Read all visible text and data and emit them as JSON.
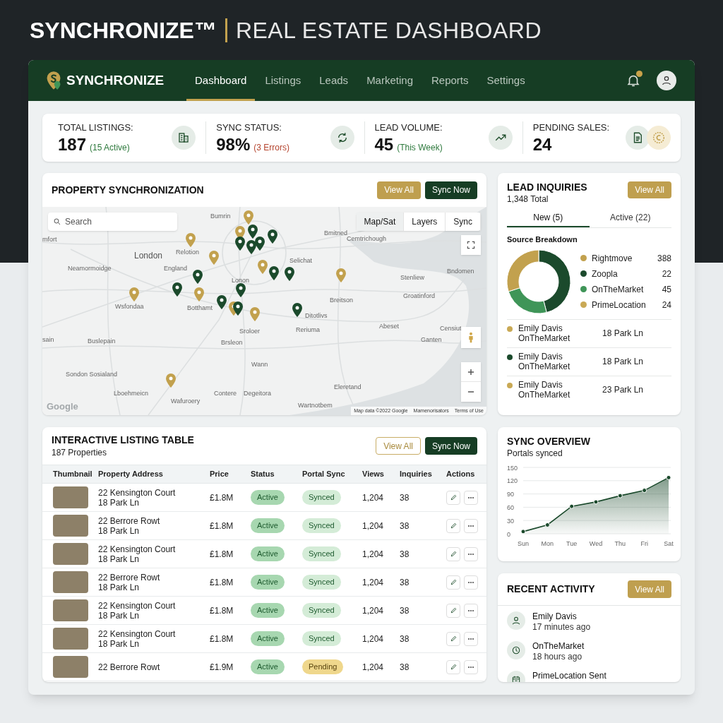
{
  "banner": {
    "brand": "SYNCHRONIZE™",
    "title": "REAL ESTATE DASHBOARD"
  },
  "nav": {
    "brand": "SYNCHRONIZE",
    "notification_dot": true,
    "tabs": [
      {
        "label": "Dashboard",
        "selected": true
      },
      {
        "label": "Listings",
        "selected": false
      },
      {
        "label": "Leads",
        "selected": false
      },
      {
        "label": "Marketing",
        "selected": false
      },
      {
        "label": "Reports",
        "selected": false
      },
      {
        "label": "Settings",
        "selected": false
      }
    ]
  },
  "stats": [
    {
      "label": "TOTAL LISTINGS:",
      "value": "187",
      "note": "(15 Active)",
      "kind": "positive"
    },
    {
      "label": "SYNC STATUS:",
      "value": "98%",
      "note": "(3 Errors)",
      "kind": "negative"
    },
    {
      "label": "LEAD VOLUME:",
      "value": "45",
      "note": "(This Week)",
      "kind": "positive"
    },
    {
      "label": "PENDING SALES:",
      "value": "24"
    }
  ],
  "property_sync": {
    "title": "PROPERTY SYNCHRONIZATION",
    "buttons": [
      {
        "label": "View All",
        "kind": "gold"
      },
      {
        "label": "Sync Now",
        "kind": "dark"
      }
    ],
    "map": {
      "search_placeholder": "Search",
      "views": [
        {
          "label": "Map/Sat",
          "selected": true
        },
        {
          "label": "Layers",
          "selected": false
        },
        {
          "label": "Sync",
          "selected": false
        }
      ],
      "place_labels": [
        "Bumrin",
        "Bmitned",
        "mfort",
        "Cemtrichough",
        "Relotion",
        "London",
        "Selichat",
        "Neamormoidge",
        "England",
        "Bndomen",
        "Lonon",
        "Stenliew",
        "Groatinford",
        "Breitson",
        "Wsfondaa",
        "Botthamt",
        "Ditotlivs",
        "Abeset",
        "Censiut",
        "Sroloer",
        "Reriuma",
        "sain",
        "Buslepain",
        "Brsleon",
        "Ganten",
        "Wann",
        "Sondon Sosialand",
        "Eleretand",
        "Lboehmeicn",
        "Contere",
        "Degeitora",
        "Wafuroery",
        "Wartnotbem"
      ],
      "pins": [
        {
          "color": "#c2a14e"
        },
        {
          "color": "#c2a14e"
        },
        {
          "color": "#c2a14e"
        },
        {
          "color": "#c2a14e"
        },
        {
          "color": "#c2a14e"
        },
        {
          "color": "#c2a14e"
        },
        {
          "color": "#c2a14e"
        },
        {
          "color": "#c2a14e"
        },
        {
          "color": "#c2a14e"
        },
        {
          "color": "#c2a14e"
        },
        {
          "color": "#c2a14e"
        },
        {
          "color": "#1b4a2c"
        },
        {
          "color": "#1b4a2c"
        },
        {
          "color": "#1b4a2c"
        },
        {
          "color": "#1b4a2c"
        },
        {
          "color": "#1b4a2c"
        },
        {
          "color": "#1b4a2c"
        },
        {
          "color": "#1b4a2c"
        },
        {
          "color": "#1b4a2c"
        },
        {
          "color": "#1b4a2c"
        },
        {
          "color": "#1b4a2c"
        },
        {
          "color": "#1b4a2c"
        },
        {
          "color": "#1b4a2c"
        },
        {
          "color": "#1b4a2c"
        }
      ],
      "logo": "Google",
      "attribution": [
        "Map data ©2022 Google",
        "Mamenorisators",
        "Terms of Use"
      ]
    }
  },
  "listing_table": {
    "title": "INTERACTIVE LISTING TABLE",
    "subtitle": "187 Properties",
    "buttons": [
      {
        "label": "View All",
        "kind": "outline"
      },
      {
        "label": "Sync Now",
        "kind": "dark"
      }
    ],
    "columns": [
      "Thumbnail",
      "Property Address",
      "Price",
      "Status",
      "Portal Sync",
      "Views",
      "Inquiries",
      "Actions"
    ],
    "rows": [
      {
        "address": "22 Kensington Court",
        "address_2": "18 Park Ln",
        "price": "£1.8M",
        "status": "Active",
        "sync": "Synced",
        "kind": "synced",
        "views": "1,204",
        "inquiries": "38"
      },
      {
        "address": "22 Berrore Rowt",
        "address_2": "18 Park Ln",
        "price": "£1.8M",
        "status": "Active",
        "sync": "Synced",
        "kind": "synced",
        "views": "1,204",
        "inquiries": "38"
      },
      {
        "address": "22 Kensington Court",
        "address_2": "18 Park Ln",
        "price": "£1.8M",
        "status": "Active",
        "sync": "Synced",
        "kind": "synced",
        "views": "1,204",
        "inquiries": "38"
      },
      {
        "address": "22 Berrore Rowt",
        "address_2": "18 Park Ln",
        "price": "£1.8M",
        "status": "Active",
        "sync": "Synced",
        "kind": "synced",
        "views": "1,204",
        "inquiries": "38"
      },
      {
        "address": "22 Kensington Court",
        "address_2": "18 Park Ln",
        "price": "£1.8M",
        "status": "Active",
        "sync": "Synced",
        "kind": "synced",
        "views": "1,204",
        "inquiries": "38"
      },
      {
        "address": "22 Kensington Court",
        "address_2": "18 Park Ln",
        "price": "£1.8M",
        "status": "Active",
        "sync": "Synced",
        "kind": "synced",
        "views": "1,204",
        "inquiries": "38"
      },
      {
        "address": "22 Berrore Rowt",
        "price": "£1.9M",
        "status": "Active",
        "sync": "Pending",
        "kind": "pending",
        "views": "1,204",
        "inquiries": "38"
      }
    ]
  },
  "leads": {
    "title": "LEAD INQUIRIES",
    "total": "1,348 Total",
    "button": "View All",
    "tabs": [
      {
        "label": "New (5)",
        "selected": true
      },
      {
        "label": "Active (22)",
        "selected": false
      }
    ],
    "section": "Source Breakdown",
    "legend": [
      {
        "name": "Rightmove",
        "value": "388",
        "color": "#c2a14e"
      },
      {
        "name": "Zoopla",
        "value": "22",
        "color": "#1b4a2c"
      },
      {
        "name": "OnTheMarket",
        "value": "45",
        "color": "#3f9558"
      },
      {
        "name": "PrimeLocation",
        "value": "24",
        "color": "#c9a955"
      }
    ],
    "items": [
      {
        "name": "Emily Davis",
        "source": "OnTheMarket",
        "address": "18 Park Ln",
        "color": "#c9a955"
      },
      {
        "name": "Emily Davis",
        "source": "OnTheMarket",
        "address": "18 Park Ln",
        "color": "#1b4a2c"
      },
      {
        "name": "Emily Davis",
        "source": "OnTheMarket",
        "address": "23 Park Ln",
        "color": "#c9a955"
      }
    ]
  },
  "sync_overview": {
    "title": "SYNC OVERVIEW",
    "chart_data": {
      "type": "area",
      "categories": [
        "Sun",
        "Mon",
        "Tue",
        "Wed",
        "Thu",
        "Fri",
        "Sat"
      ],
      "series": [
        {
          "name": "Portals synced",
          "color": "#1b4a2c",
          "values": [
            5,
            20,
            62,
            72,
            86,
            98,
            127
          ]
        }
      ],
      "ylim": [
        0,
        150
      ],
      "yticks": [
        0,
        30,
        60,
        90,
        120,
        150
      ],
      "grid": true
    }
  },
  "recent_activity": {
    "title": "RECENT ACTIVITY",
    "button": "View All",
    "items": [
      {
        "title": "Emily Davis",
        "time": "17 minutes ago"
      },
      {
        "title": "OnTheMarket",
        "time": "18 hours ago"
      },
      {
        "title": "PrimeLocation Sent"
      }
    ]
  }
}
